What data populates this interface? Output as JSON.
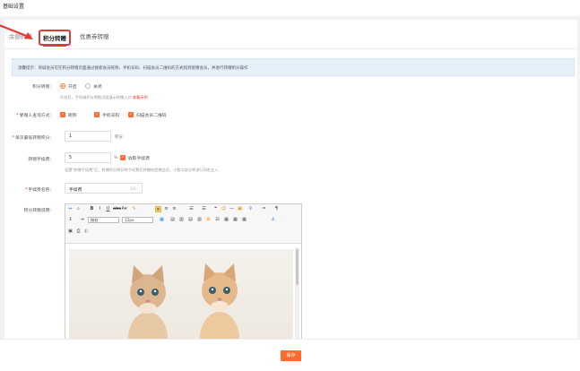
{
  "page_title": "基础设置",
  "tabs": [
    {
      "label": "余额转赠"
    },
    {
      "label": "积分转赠"
    },
    {
      "label": "优惠券转赠"
    }
  ],
  "notice": "温馨提示：商城会员可在积分转赠页面通过搜索会员昵称、手机号码、扫描会员二维码的方式找到受赠会员，并进行转赠积分操作",
  "form": {
    "switch": {
      "label": "积分转赠:",
      "options": [
        "开启",
        "关闭"
      ],
      "selected": "开启",
      "hint": "开启后，手机端积分明细页面展示转赠入口",
      "hint_link": "查看示例"
    },
    "search_method": {
      "label": "受赠人查询方式:",
      "options": [
        "昵称",
        "手机号码",
        "扫描会员二维码"
      ]
    },
    "min_points": {
      "label": "单次最低转赠积分:",
      "value": "1",
      "unit": "积分"
    },
    "fee": {
      "label": "转赠手续费:",
      "value": "5",
      "unit": "%",
      "check_label": "收取手续费",
      "hint": "设置\"转赠手续费\"后，转赠积分将扣除手续费后转赠给受赠会员，小数点部分将进行四舍五入"
    },
    "fee_name": {
      "label": "手续费名称:",
      "value": "手续费",
      "counter": "3/6"
    },
    "description": {
      "label": "积分转赠说明:",
      "font_select": "微软",
      "size_select": "12px"
    }
  },
  "footer": {
    "save_label": "保存"
  },
  "colors": {
    "accent": "#ff6a2a",
    "highlight": "#e53935",
    "link": "#1677ff"
  }
}
